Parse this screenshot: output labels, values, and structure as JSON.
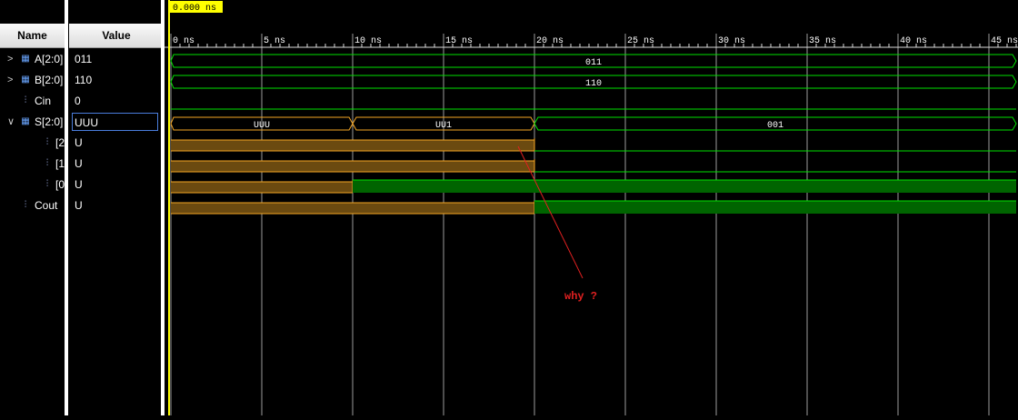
{
  "columns": {
    "name": "Name",
    "value": "Value"
  },
  "cursor": {
    "time_label": "0.000 ns"
  },
  "timescale": {
    "ticks": [
      "0 ns",
      "5 ns",
      "10 ns",
      "15 ns",
      "20 ns",
      "25 ns",
      "30 ns",
      "35 ns",
      "40 ns",
      "45 ns"
    ]
  },
  "signals": [
    {
      "name": "A[2:0]",
      "value": "011",
      "type": "bus",
      "expandable": true,
      "segments": [
        {
          "t0": 0,
          "t1": 46.5,
          "label": "011"
        }
      ]
    },
    {
      "name": "B[2:0]",
      "value": "110",
      "type": "bus",
      "expandable": true,
      "segments": [
        {
          "t0": 0,
          "t1": 46.5,
          "label": "110"
        }
      ]
    },
    {
      "name": "Cin",
      "value": "0",
      "type": "bit",
      "segments": [
        {
          "t0": 0,
          "t1": 46.5,
          "v": "0"
        }
      ]
    },
    {
      "name": "S[2:0]",
      "value": "UUU",
      "type": "bus",
      "expandable": true,
      "expanded": true,
      "selected": true,
      "segments": [
        {
          "t0": 0,
          "t1": 10,
          "label": "UUU",
          "u": true
        },
        {
          "t0": 10,
          "t1": 20,
          "label": "UU1",
          "u": true
        },
        {
          "t0": 20,
          "t1": 46.5,
          "label": "001"
        }
      ]
    },
    {
      "name": "[2",
      "value": "U",
      "type": "bit",
      "child": true,
      "segments": [
        {
          "t0": 0,
          "t1": 20,
          "v": "U"
        },
        {
          "t0": 20,
          "t1": 46.5,
          "v": "0"
        }
      ]
    },
    {
      "name": "[1",
      "value": "U",
      "type": "bit",
      "child": true,
      "segments": [
        {
          "t0": 0,
          "t1": 20,
          "v": "U"
        },
        {
          "t0": 20,
          "t1": 46.5,
          "v": "0"
        }
      ]
    },
    {
      "name": "[0",
      "value": "U",
      "type": "bit",
      "child": true,
      "segments": [
        {
          "t0": 0,
          "t1": 10,
          "v": "U"
        },
        {
          "t0": 10,
          "t1": 46.5,
          "v": "1"
        }
      ]
    },
    {
      "name": "Cout",
      "value": "U",
      "type": "bit",
      "segments": [
        {
          "t0": 0,
          "t1": 20,
          "v": "U"
        },
        {
          "t0": 20,
          "t1": 46.5,
          "v": "1"
        }
      ]
    }
  ],
  "annotation": {
    "text": "why ?",
    "color": "#e02020"
  },
  "colors": {
    "background": "#000000",
    "wave": "#00e000",
    "high_fill": "#006400",
    "undefined": "#f5a623",
    "undefined_fill": "#6b4a10",
    "cursor": "#ffff00",
    "grid": "#cfcfcf"
  }
}
